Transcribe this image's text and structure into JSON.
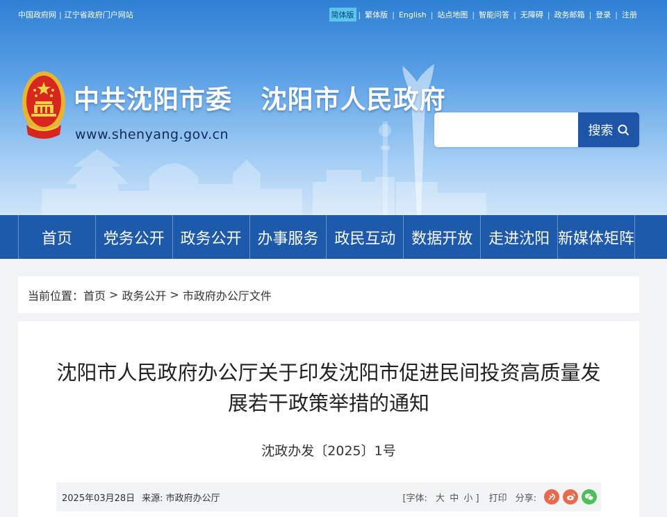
{
  "topbar": {
    "left_links": [
      "中国政府网",
      "辽宁省政府门户网站"
    ],
    "right_links": [
      "简体版",
      "繁体版",
      "English",
      "站点地图",
      "智能问答",
      "无障碍",
      "政务邮箱",
      "登录",
      "注册"
    ],
    "active_index": 0,
    "active_color": "#59c6ea"
  },
  "header": {
    "title": "中共沈阳市委   沈阳市人民政府",
    "url": "www.shenyang.gov.cn",
    "search": {
      "placeholder": "",
      "button_label": "搜索"
    }
  },
  "nav": {
    "items": [
      "首页",
      "党务公开",
      "政务公开",
      "办事服务",
      "政民互动",
      "数据开放",
      "走进沈阳",
      "新媒体矩阵"
    ],
    "color": "#1d5aab"
  },
  "breadcrumb": {
    "label": "当前位置：",
    "items": [
      "首页",
      "政务公开",
      "市政府办公厅文件"
    ],
    "separator": ">"
  },
  "article": {
    "title": "沈阳市人民政府办公厅关于印发沈阳市促进民间投资高质量发展若干政策举措的通知",
    "doc_number": "沈政办发〔2025〕1号",
    "date": "2025年03月28日",
    "source_label": "来源:",
    "source": "市政府办公厅",
    "font_label": "[字体:",
    "font_sizes": [
      "大",
      "中",
      "小"
    ],
    "font_close": "]",
    "print_label": "打印",
    "share_label": "分享:",
    "share_icons": [
      "party-icon",
      "weibo-icon",
      "wechat-icon"
    ],
    "share_colors": [
      "#e86a4a",
      "#e86a4a",
      "#4cbf5a"
    ]
  }
}
